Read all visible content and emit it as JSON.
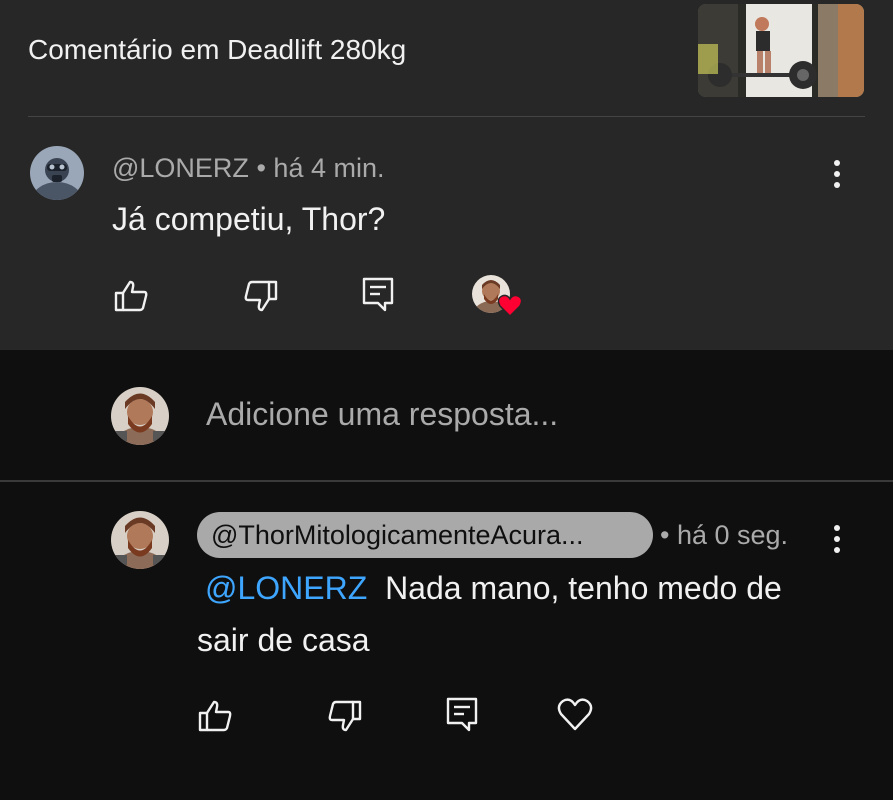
{
  "header": {
    "title": "Comentário em Deadlift 280kg",
    "thumbnail_icon": "video-thumbnail"
  },
  "comment": {
    "author": "@LONERZ",
    "separator": "•",
    "time": "há 4 min.",
    "text": "Já competiu, Thor?",
    "actions": [
      "like-icon",
      "dislike-icon",
      "reply-icon",
      "creator-heart-badge"
    ],
    "heart_color": "#ff0033"
  },
  "reply_box": {
    "placeholder": "Adicione uma resposta..."
  },
  "reply": {
    "author": "@ThorMitologicamenteAcura...",
    "separator": "•",
    "time": "há 0 seg.",
    "mention": "@LONERZ",
    "text_line1": "Nada mano, tenho medo de",
    "text_line2": "sair de casa",
    "actions": [
      "like-icon",
      "dislike-icon",
      "reply-icon",
      "heart-icon"
    ]
  },
  "colors": {
    "top_background": "#272727",
    "page_background": "#0f0f0f",
    "mention": "#3ea6ff",
    "secondary_text": "#aaaaaa"
  }
}
